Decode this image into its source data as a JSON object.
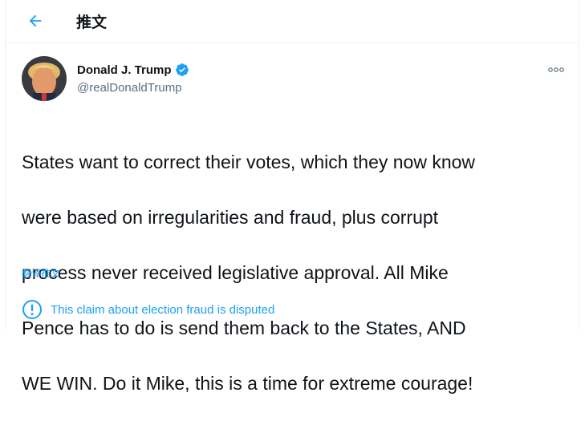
{
  "header": {
    "title": "推文",
    "back_icon": "arrow-left-icon"
  },
  "tweet": {
    "author_name": "Donald J. Trump",
    "verified_icon": "verified-badge-icon",
    "handle": "@realDonaldTrump",
    "more_icon": "more-options-icon",
    "lines": [
      "States want to correct their votes, which they now know",
      "were based on irregularities and fraud, plus corrupt",
      "process never received legislative approval.  All Mike",
      "Pence has to do is send them back to the States, AND",
      "WE WIN. Do it Mike, this is a time for extreme courage!"
    ],
    "translate_label": "翻译推文"
  },
  "notice": {
    "icon": "exclamation-circle-icon",
    "text": "This claim about election fraud is disputed"
  },
  "colors": {
    "accent": "#1da1f2",
    "text": "#0f1419",
    "secondary": "#5b7083"
  }
}
